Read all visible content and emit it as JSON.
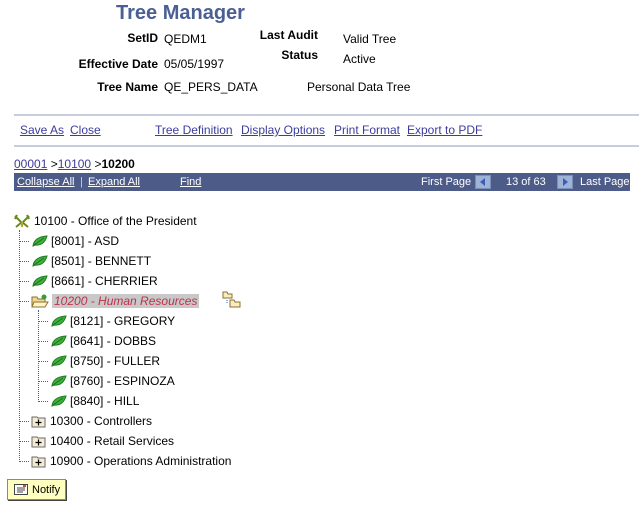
{
  "page": {
    "title": "Tree Manager"
  },
  "header": {
    "setid_label": "SetID",
    "setid_value": "QEDM1",
    "effdate_label": "Effective Date",
    "effdate_value": "05/05/1997",
    "treename_label": "Tree Name",
    "treename_value": "QE_PERS_DATA",
    "tree_description": "Personal Data Tree",
    "last_audit_label": "Last Audit",
    "last_audit_value": "Valid Tree",
    "status_label": "Status",
    "status_value": "Active"
  },
  "actions": {
    "save_as": "Save As",
    "close": "Close",
    "tree_definition": "Tree Definition",
    "display_options": "Display Options",
    "print_format": "Print Format",
    "export_pdf": "Export to PDF"
  },
  "breadcrumb": {
    "items": [
      "00001",
      "10100"
    ],
    "separator": ">",
    "current": "10200"
  },
  "toolbar": {
    "collapse_all": "Collapse All",
    "divider": "|",
    "expand_all": "Expand All",
    "find": "Find",
    "first_page": "First Page",
    "page_info": "13 of 63",
    "last_page": "Last Page"
  },
  "tree": {
    "root": {
      "label": "10100 - Office of the President",
      "icon": "root-node-icon"
    },
    "children": [
      {
        "label": "[8001] - ASD",
        "icon": "leaf-icon"
      },
      {
        "label": "[8501] - BENNETT",
        "icon": "leaf-icon"
      },
      {
        "label": "[8661] - CHERRIER",
        "icon": "leaf-icon"
      },
      {
        "label": "10200 - Human Resources",
        "icon": "open-folder-icon",
        "selected": true,
        "children": [
          {
            "label": "[8121] - GREGORY",
            "icon": "leaf-icon"
          },
          {
            "label": "[8641] - DOBBS",
            "icon": "leaf-icon"
          },
          {
            "label": "[8750] - FULLER",
            "icon": "leaf-icon"
          },
          {
            "label": "[8760] - ESPINOZA",
            "icon": "leaf-icon"
          },
          {
            "label": "[8840] - HILL",
            "icon": "leaf-icon"
          }
        ]
      },
      {
        "label": "10300 - Controllers",
        "icon": "expand-plus-icon"
      },
      {
        "label": "10400 - Retail Services",
        "icon": "expand-plus-icon"
      },
      {
        "label": "10900 - Operations Administration",
        "icon": "expand-plus-icon"
      }
    ]
  },
  "notify": {
    "label": "Notify"
  },
  "colors": {
    "title": "#4a5f93",
    "toolbar_bg": "#4d5b89",
    "link": "#3c3c9c",
    "selected_text": "#c0304a",
    "selected_bg": "#c8c8c8",
    "leaf_green": "#2e9e2e",
    "notify_bg": "#ffffc0"
  }
}
